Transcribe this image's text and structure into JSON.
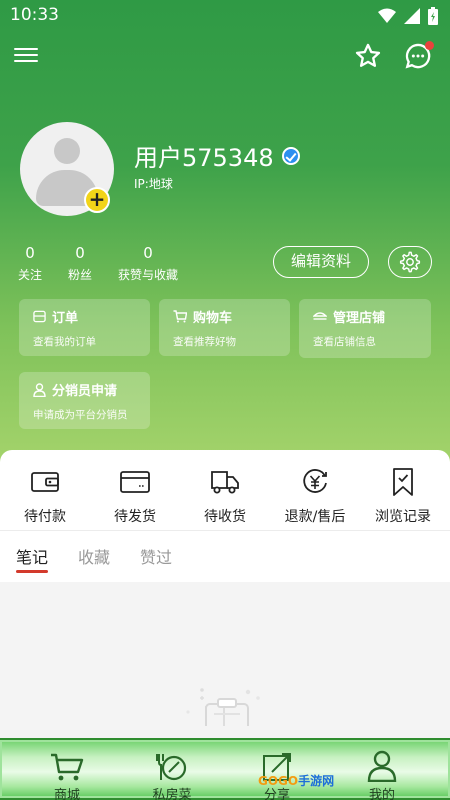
{
  "status": {
    "time": "10:33"
  },
  "profile": {
    "username": "用户575348",
    "ip": "IP:地球",
    "stats": [
      {
        "num": "0",
        "label": "关注"
      },
      {
        "num": "0",
        "label": "粉丝"
      },
      {
        "num": "0",
        "label": "获赞与收藏"
      }
    ],
    "edit_label": "编辑资料"
  },
  "cards": [
    {
      "title": "订单",
      "sub": "查看我的订单",
      "icon": "order-icon"
    },
    {
      "title": "购物车",
      "sub": "查看推荐好物",
      "icon": "cart-icon"
    },
    {
      "title": "管理店铺",
      "sub": "查看店铺信息",
      "icon": "shop-icon"
    },
    {
      "title": "分销员申请",
      "sub": "申请成为平台分销员",
      "icon": "person-icon"
    }
  ],
  "orders": [
    {
      "label": "待付款",
      "icon": "wallet-icon"
    },
    {
      "label": "待发货",
      "icon": "card-icon"
    },
    {
      "label": "待收货",
      "icon": "truck-icon"
    },
    {
      "label": "退款/售后",
      "icon": "yuan-refund-icon"
    },
    {
      "label": "浏览记录",
      "icon": "bookmark-icon"
    }
  ],
  "tabs": [
    {
      "label": "笔记"
    },
    {
      "label": "收藏"
    },
    {
      "label": "赞过"
    }
  ],
  "nav": [
    {
      "label": "商城",
      "icon": "cart-icon"
    },
    {
      "label": "私房菜",
      "icon": "dish-icon"
    },
    {
      "label": "分享",
      "icon": "share-icon"
    },
    {
      "label": "我的",
      "icon": "person-icon"
    }
  ],
  "watermark": {
    "brand": "GOGO",
    "suffix": "手游网"
  },
  "colors": {
    "accent": "#3ea24a",
    "tab_indicator": "#d33a2c",
    "verified": "#2d8ff0",
    "add_badge": "#f2d418"
  }
}
